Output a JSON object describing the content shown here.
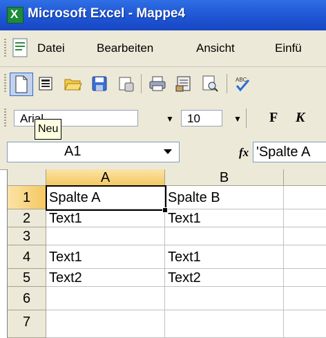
{
  "window": {
    "title": "Microsoft Excel - Mappe4"
  },
  "menu": {
    "items": [
      {
        "label": "Datei"
      },
      {
        "label": "Bearbeiten"
      },
      {
        "label": "Ansicht"
      },
      {
        "label": "Einfü"
      }
    ]
  },
  "toolbar": {
    "buttons": [
      "new-icon",
      "save-doc-icon",
      "open-icon",
      "save-icon",
      "permission-icon",
      "print-icon",
      "print-preview-icon",
      "preview-icon",
      "spelling-icon"
    ]
  },
  "format": {
    "font_value": "Arial",
    "size_value": "10",
    "bold_label": "F",
    "italic_label": "K"
  },
  "tooltip": {
    "text": "Neu"
  },
  "formula": {
    "name_box": "A1",
    "fx_label": "fx",
    "content": "'Spalte A"
  },
  "sheet": {
    "columns": [
      "A",
      "B"
    ],
    "rows": [
      {
        "num": "1",
        "a": "Spalte A",
        "b": "Spalte B"
      },
      {
        "num": "2",
        "a": "Text1",
        "b": "Text1"
      },
      {
        "num": "3",
        "a": "",
        "b": ""
      },
      {
        "num": "4",
        "a": "Text1",
        "b": "Text1"
      },
      {
        "num": "5",
        "a": "Text2",
        "b": "Text2"
      },
      {
        "num": "6",
        "a": "",
        "b": ""
      },
      {
        "num": "7",
        "a": "",
        "b": ""
      }
    ],
    "active_cell": "A1"
  },
  "colors": {
    "titlebar": "#2159d6",
    "chrome": "#ece9d8",
    "header_selected": "#f5c862"
  }
}
